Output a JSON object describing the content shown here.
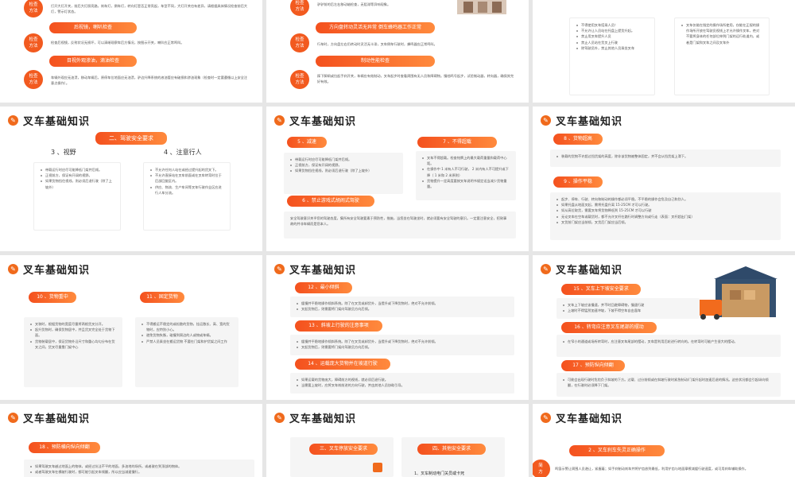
{
  "common": {
    "slide_title": "叉车基础知识",
    "logo_glyph": "✎"
  },
  "s00": {
    "method_top": "检查\n方法",
    "method_top_text": "打开大灯开关，前后大灯照亮路，刹车灯，倒车灯，转向灯是否正常亮起，车型不同，大灯开关也有差异，请根据具体情况检查前后大灯，警示灯状态。",
    "pill1": "后视镜，喇叭检查",
    "method1": "检查\n方法",
    "text1": "检查后视镜，反射状况无损坏，可以清晰观察车后方情况，按图示开关，喇叭应正常鸣叫。",
    "pill2": "目视外观渗油，滴油检查",
    "method2": "检查\n方法",
    "text2": "车辆外观应无油渍，移动车辆后，原停车位地面应无油渍，驴边升降系统的液油管应有破损和渗油现象（检查时一定要遵循以上安全注意点操作）。"
  },
  "s01": {
    "method_top": "检查\n方法",
    "top_text": "驴驴前的后左右移动轴检查，无阻滞等异响现象。",
    "pill1": "方向盘转动灵活无异常 倒车蜂鸣器工作正常",
    "method1": "检查\n方法",
    "text1": "行车时，方向盘左右仍转动时灵活无卡滞，叉车倒车行驶时，蜂鸣器应正常鸣叫。",
    "pill2": "制动性能检查",
    "method2": "检查\n方法",
    "text2": "踩下脚闸或拉起手刹开关，车辆应有效制动，叉车起步时查看周围有无人员和障碍物。慢档鸣号起步，试验制动器，转向器，确保其完好有效。"
  },
  "s02": {
    "left": [
      "不得使用叉车搭乘人员！",
      "不允许让人员站在托盘上提货升起。",
      "禁止用叉车提升人员",
      "禁止人员站在货叉上行驶",
      "除驾驶员外，禁止其他人员乘坐叉车"
    ],
    "right": [
      "叉车仅能在指定的操作场所使用，仅能在正规的操作场所开放在驾驶员视线上才允许操作叉车，绝对不要将身体的任何部位伸到门架的运行轨道内，或者是门架和叉车之间及叉车外"
    ]
  },
  "s10": {
    "pill": "二、驾驶安全要求",
    "h3": "3 、视野",
    "h4": "4 、注意行人",
    "left": [
      "带载运行时应尽可能降低门架并后倾。",
      "正视前方，保证有开阔的视野。",
      "如果货物挡住视线，则必须后退行驶（除了上坡外）"
    ],
    "right": [
      "不允许任何人站在或经过提升起的货叉下。",
      "不允许直接站在叉车前面或在叉车转弯时位于后部回旋区内。",
      "供应、物流、生产车间等叉车行驶作业区应进行人车分流。"
    ]
  },
  "s11": {
    "pill5": "5 、减速",
    "pill7": "7 、不得超载",
    "list5": [
      "带载运行时应尽可能降低门架并后倾。",
      "正视前方，保证有开阔的视野。",
      "如果货物挡住视线，则必须后退行驶（除了上坡外）"
    ],
    "list7": [
      "叉车不得超载。检查铭牌上的最大载荷重量和载荷中心距。",
      "在操作中 1 米有人不可行驶， 2 米内有人不可提升或下降（ 1 米和 2 米原则）",
      "货物提升一定高度要按叉车说明书规定适当减少货物重量。"
    ],
    "pill6": "6 、禁止游戏式胡闹式驾驶",
    "text6": "安全驾驶意识关乎您的驾驶态度，集所有安全驾驶要素于预防性，措施，当您坐在驾驶坐时，就必须要有安全驾驶的意识。一定要注意安全，招致事故的并非车辆而是您本人。"
  },
  "s12": {
    "pill8": "8 、货物超高",
    "text8": "装载的货物不许超过挡货架的高度，除非该货物被整体固定，并不会从挡货架上滑下。",
    "pill9": "9 、操作平稳",
    "list9": [
      "起步、停车、行驶、转向和制动的操作都必须平稳。不平稳的操作会危及自己和别人。",
      "如果托盘从地面叉起，需将托盘升离 15-25CM 才可以行驶。",
      "如从高位取货，需要叉车将货物降低到 15-25CM 才可以行驶",
      "无论叉车在空车或载货时，都不允许叉杆在路行时调整方向或行走（表面：叉杆超出门架）",
      "叉货前门架应当前倾，叉货后门架应当后倾。"
    ]
  },
  "s20": {
    "pill10": "10 、货物重中",
    "pill11": "11 、固定货物",
    "list10": [
      "叉装时，根据货物的宽度尽量将两根货叉分开。",
      "起升货物时，确保货物居中，并且货叉完全处于货物下面。",
      "货物装载居中，保证货物外沿尺寸和重心均匀分布在货叉之间，货叉尽量靠门架中心"
    ],
    "list11": [
      "不得搬运不稳定的或松散的货物，挂运散长、高、宽的货物时，应特别小心。",
      "避免货物失衡，碰撞到周边的人或物或车辆。",
      "严禁人员乘坐在搬运货物 不要在门架和护货架之间工作"
    ]
  },
  "s21": {
    "pill12": "12 、最小倾斜",
    "list12": [
      "缓慢并平稳地操作倾斜系统。除了在叉货或卸货外，当提升或下降货物时，绝对不允许前倾。",
      "叉起货物后，则需要将门架向驾驶员方向后倾。"
    ],
    "pill13": "13 、斜坡上行驶的注意事项",
    "list13": [
      "缓慢并平稳地操作倾斜系统。除了在叉货或卸货外，当提升或下降货物时，绝对不允许前倾。",
      "叉起货物后，则需要将门架向驾驶员方向后倾。"
    ],
    "pill14": "14 、运载庞大货物并在坡道行驶",
    "list14": [
      "如果运载的货物庞大，障碍前方的视线，就必须后退行驶。",
      "当需要上坡时，应将叉车刹前进的方向行驶，并由其他人员协助引导。"
    ]
  },
  "s22": {
    "pill15": "15 、叉车上下坡安全要求",
    "list15": [
      "叉车上下坡应该慢速，并不时回避障碍物，慢速行驶",
      "上坡时不得猛然加速冲坡，下坡不得空车自由溜车"
    ],
    "pill16": "16 、转弯应注意叉车尾部的摆动",
    "list16": [
      "在窄小的通道或场所转弯时，应注意叉车尾部的摆动，叉车是利用后轮进行转向的。在转弯时可能产生很大的摆动。"
    ],
    "pill17": "17 、预防纵向倾翻",
    "list17": [
      "可能会出现行驶时危险负于斜坡的下方。过载、过分前倾或在斜坡行驶时紧急制动/门架升起时加速后退的情况。这些状况都会引起纵向倾翻，在行驶时必须降下门架。"
    ]
  },
  "s30": {
    "pill18": "18 、预防横向纵向倾翻",
    "list18": [
      "如果驾驶叉车越过地面上的物体，或经过坑洼不平的地面，多油地的场所，或者驶在到顶部的物体。",
      "或者驾驶叉车在横坡行驶时，都可能引起叉车倾翻，所以应当减速慢行。"
    ]
  },
  "s31": {
    "pill3": "三、叉车停放安全要求",
    "pill4": "四、其他安全要求",
    "item1": "1、叉车制动电门关员或卡死"
  },
  "s32": {
    "pill": "2 、叉车刹车失灵正确操作",
    "method": "简\n方",
    "text": "鸣笛示警让周围人员避让，紧握着；如手刹制动刹车并将铲齿放到最低，利用铲齿与地面摩擦减缓行驶速度，或可用刹车辅助操作。"
  }
}
